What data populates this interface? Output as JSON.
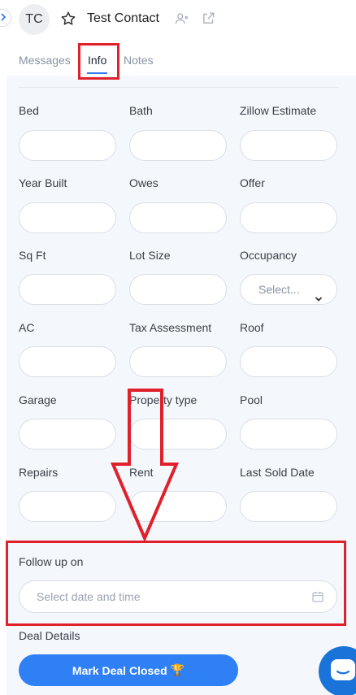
{
  "header": {
    "avatar_initials": "TC",
    "contact_name": "Test Contact"
  },
  "tabs": [
    {
      "label": "Messages",
      "active": false
    },
    {
      "label": "Info",
      "active": true
    },
    {
      "label": "Notes",
      "active": false
    }
  ],
  "fields": [
    {
      "label": "Bed",
      "type": "text",
      "value": ""
    },
    {
      "label": "Bath",
      "type": "text",
      "value": ""
    },
    {
      "label": "Zillow Estimate",
      "type": "text",
      "value": ""
    },
    {
      "label": "Year Built",
      "type": "text",
      "value": ""
    },
    {
      "label": "Owes",
      "type": "text",
      "value": ""
    },
    {
      "label": "Offer",
      "type": "text",
      "value": ""
    },
    {
      "label": "Sq Ft",
      "type": "text",
      "value": ""
    },
    {
      "label": "Lot Size",
      "type": "text",
      "value": ""
    },
    {
      "label": "Occupancy",
      "type": "select",
      "value": "Select..."
    },
    {
      "label": "AC",
      "type": "text",
      "value": ""
    },
    {
      "label": "Tax Assessment",
      "type": "text",
      "value": ""
    },
    {
      "label": "Roof",
      "type": "text",
      "value": ""
    },
    {
      "label": "Garage",
      "type": "text",
      "value": ""
    },
    {
      "label": "Property type",
      "type": "text",
      "value": ""
    },
    {
      "label": "Pool",
      "type": "text",
      "value": ""
    },
    {
      "label": "Repairs",
      "type": "text",
      "value": ""
    },
    {
      "label": "Rent",
      "type": "text",
      "value": ""
    },
    {
      "label": "Last Sold Date",
      "type": "text",
      "value": ""
    }
  ],
  "follow_up": {
    "label": "Follow up on",
    "placeholder": "Select date and time"
  },
  "deal": {
    "label": "Deal Details",
    "button_label": "Mark Deal Closed",
    "button_emoji": "🏆"
  },
  "colors": {
    "accent": "#2f80f5",
    "annotation": "#e0202b",
    "panel_bg": "#f4f7fc"
  }
}
